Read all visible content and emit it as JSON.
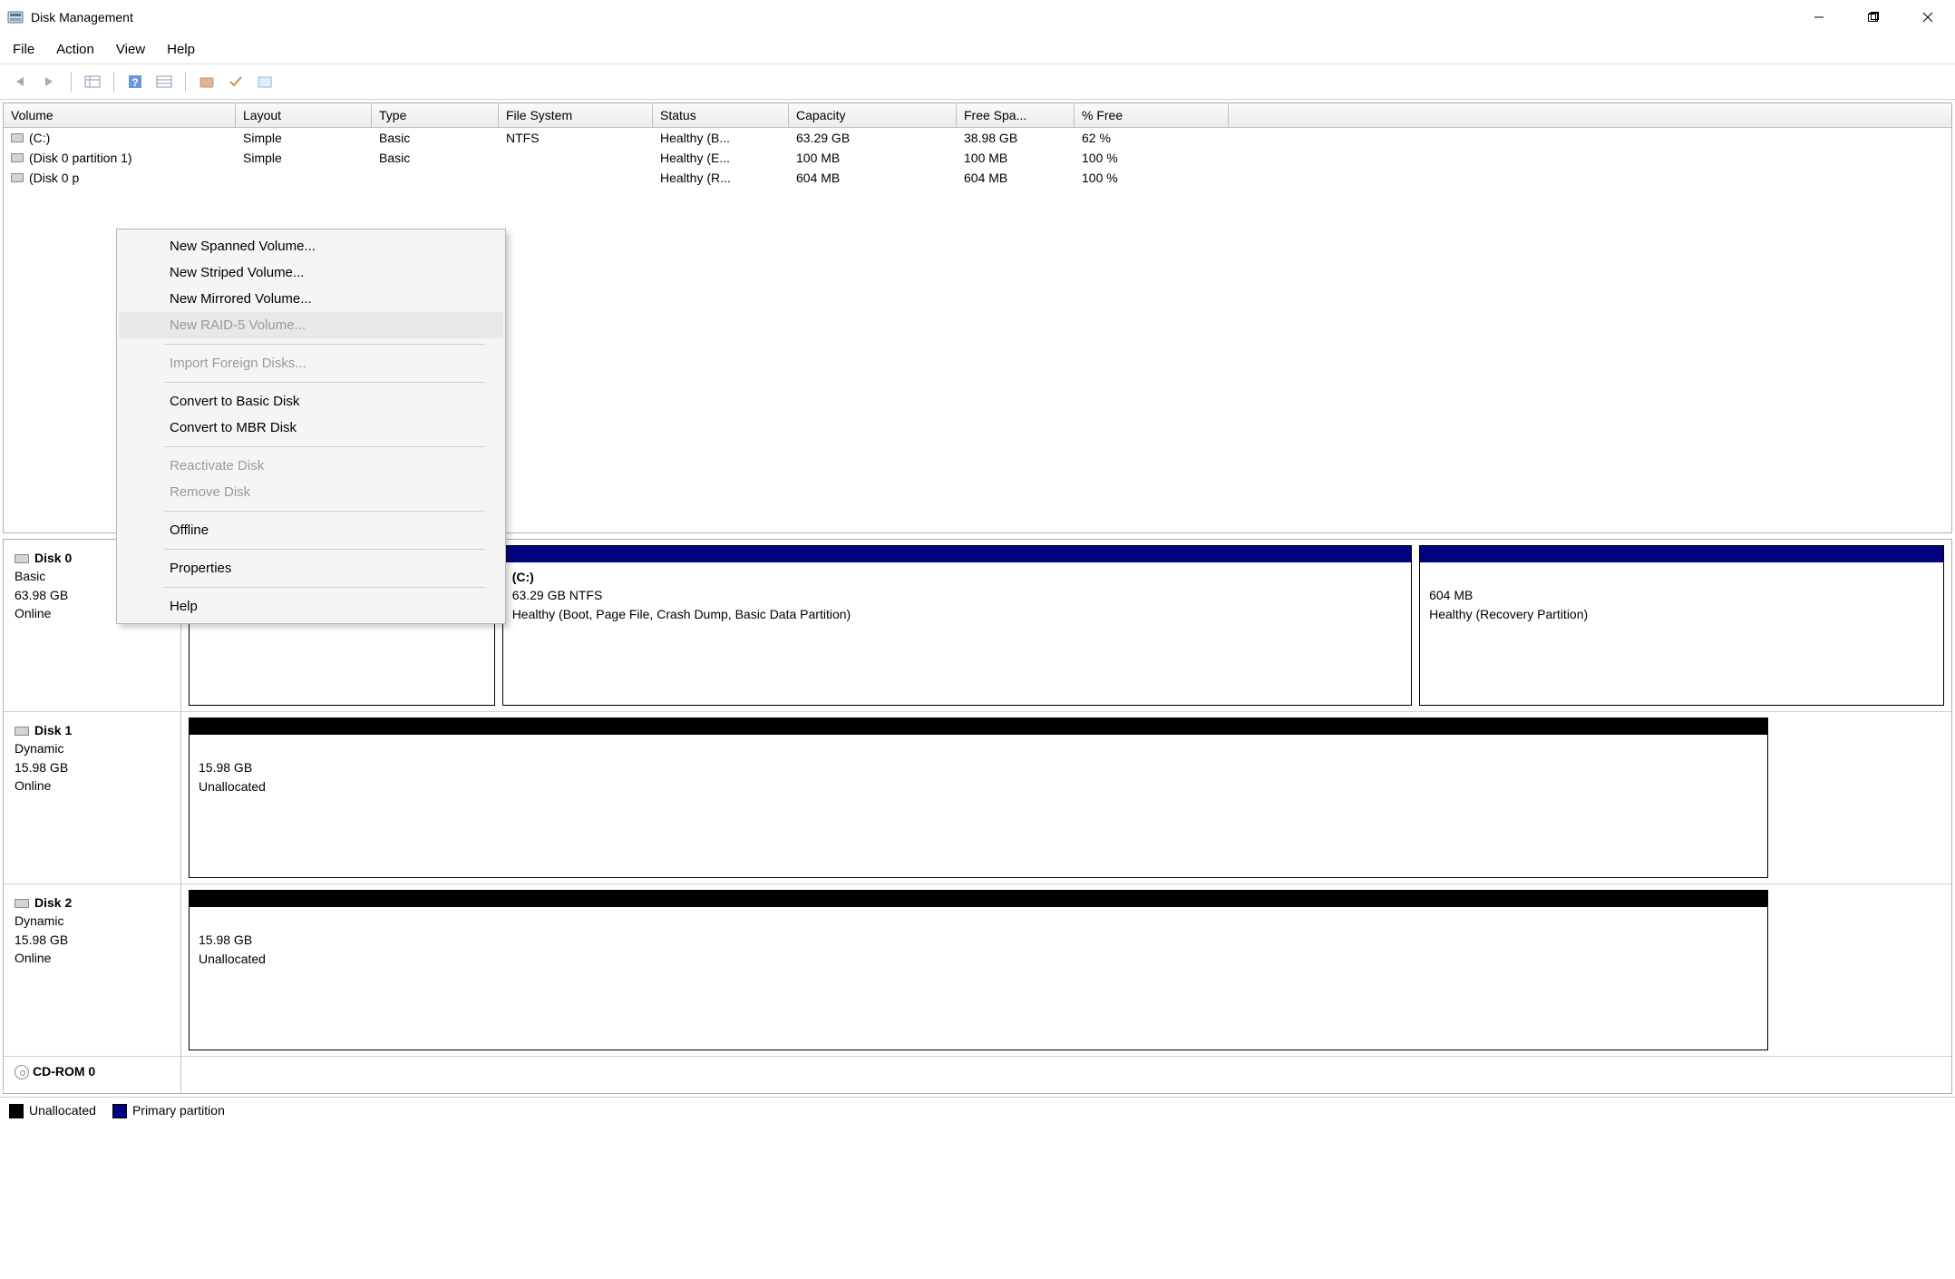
{
  "app": {
    "title": "Disk Management"
  },
  "menubar": {
    "file": "File",
    "action": "Action",
    "view": "View",
    "help": "Help"
  },
  "columns": {
    "volume": "Volume",
    "layout": "Layout",
    "type": "Type",
    "fs": "File System",
    "status": "Status",
    "capacity": "Capacity",
    "free": "Free Spa...",
    "pct": "% Free"
  },
  "volumes": [
    {
      "name": "(C:)",
      "layout": "Simple",
      "type": "Basic",
      "fs": "NTFS",
      "status": "Healthy (B...",
      "cap": "63.29 GB",
      "free": "38.98 GB",
      "pct": "62 %"
    },
    {
      "name": "(Disk 0 partition 1)",
      "layout": "Simple",
      "type": "Basic",
      "fs": "",
      "status": "Healthy (E...",
      "cap": "100 MB",
      "free": "100 MB",
      "pct": "100 %"
    },
    {
      "name": "(Disk 0 p",
      "layout": "",
      "type": "",
      "fs": "",
      "status": "Healthy (R...",
      "cap": "604 MB",
      "free": "604 MB",
      "pct": "100 %"
    }
  ],
  "disks": {
    "d0": {
      "name": "Disk 0",
      "type": "Basic",
      "size": "63.98 GB",
      "state": "Online",
      "p1": {
        "title": "(C:)",
        "line1": "63.29 GB NTFS",
        "line2": "Healthy (Boot, Page File, Crash Dump, Basic Data Partition)"
      },
      "p2": {
        "line1": "604 MB",
        "line2": "Healthy (Recovery Partition)"
      }
    },
    "d1": {
      "name": "Disk 1",
      "type": "Dynamic",
      "size": "15.98 GB",
      "state": "Online",
      "p1": {
        "line1": "15.98 GB",
        "line2": "Unallocated"
      }
    },
    "d2": {
      "name": "Disk 2",
      "type": "Dynamic",
      "size": "15.98 GB",
      "state": "Online",
      "p1": {
        "line1": "15.98 GB",
        "line2": "Unallocated"
      }
    },
    "cd": {
      "name": "CD-ROM 0"
    }
  },
  "legend": {
    "unalloc": "Unallocated",
    "primary": "Primary partition"
  },
  "context_menu": {
    "spanned": "New Spanned Volume...",
    "striped": "New Striped Volume...",
    "mirrored": "New Mirrored Volume...",
    "raid5": "New RAID-5 Volume...",
    "import": "Import Foreign Disks...",
    "to_basic": "Convert to Basic Disk",
    "to_mbr": "Convert to MBR Disk",
    "reactivate": "Reactivate Disk",
    "remove": "Remove Disk",
    "offline": "Offline",
    "properties": "Properties",
    "help": "Help"
  },
  "colors": {
    "primary": "#02027e",
    "unallocated": "#000000"
  }
}
